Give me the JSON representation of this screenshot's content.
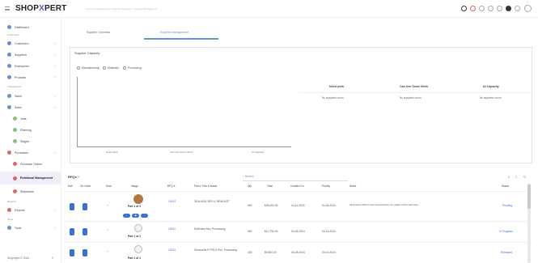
{
  "header": {
    "brand_main": "SHOP",
    "brand_x": "X",
    "brand_rest": "PERT",
    "breadcrumb": "Inventory Management / Supplier Overview / Supplier Management"
  },
  "sidebar": {
    "items": [
      {
        "label": "Dashboard"
      },
      {
        "section": "Customers"
      },
      {
        "label": "Customers"
      },
      {
        "label": "Suppliers"
      },
      {
        "label": "Employees"
      },
      {
        "label": "Products"
      },
      {
        "section": "Transactions"
      },
      {
        "label": "Sales"
      },
      {
        "label": "Sales"
      },
      {
        "label": "Jobs"
      },
      {
        "label": "Planning"
      },
      {
        "label": "Stages"
      },
      {
        "label": "Purchases"
      },
      {
        "label": "Purchase Orders"
      },
      {
        "label": "Relational Management"
      },
      {
        "label": "Shipments"
      },
      {
        "section": "Reports"
      },
      {
        "label": "Reports"
      },
      {
        "section": "Tools"
      },
      {
        "label": "Tools"
      }
    ],
    "footer": "ShopXpert © 2024"
  },
  "tabs": [
    {
      "label": "Supplier Overview"
    },
    {
      "label": "Supplier Management"
    }
  ],
  "capacity": {
    "title": "Supplier Capacity",
    "filters": [
      "Manufacturing",
      "Materials",
      "Processing"
    ],
    "x_labels": [
      "Need Work",
      "Can Use Some Work",
      "At Capacity"
    ],
    "headers": [
      "Need work",
      "Can Use Some Work",
      "At Capacity"
    ],
    "values": [
      "No suppliers found",
      "No suppliers found",
      "No suppliers found"
    ]
  },
  "rfq": {
    "title": "RFQs",
    "search_placeholder": "Search",
    "columns": [
      "Edit",
      "On Order",
      "Hold",
      "Image",
      "RFQ #",
      "Part #, Rev & Name",
      "Qty",
      "Total",
      "Created On",
      "Priority",
      "Notes",
      "Status"
    ],
    "rows": [
      {
        "part_label": "Part 1 of 3",
        "rfq": "10012",
        "part": "3104-0001 REV A, BRACKET",
        "qty": "500",
        "total": "$25,000.00",
        "created": "04-11-2024",
        "priority": "04-30-2024",
        "notes": "Need quote ASAP for upcoming production run, please confirm lead times",
        "status": "Pending"
      },
      {
        "part_label": "Part 1 of 1",
        "rfq": "10011",
        "part": "Edit/Labs Rev, Processing",
        "qty": "350",
        "total": "$12,750.00",
        "created": "04-05-2024",
        "priority": "04-15-2024",
        "notes": "",
        "status": "In Progress"
      },
      {
        "part_label": "Part 1 of 1",
        "rfq": "10010",
        "part": "Stonecells P-PROJ Rev, Processing",
        "qty": "150",
        "total": "$9,500.00",
        "created": "03-28-2024",
        "priority": "04-10-2024",
        "notes": "",
        "status": "Released"
      }
    ]
  },
  "colors": {
    "accent": "#3a6fd8",
    "brand": "#6a4fc7"
  }
}
